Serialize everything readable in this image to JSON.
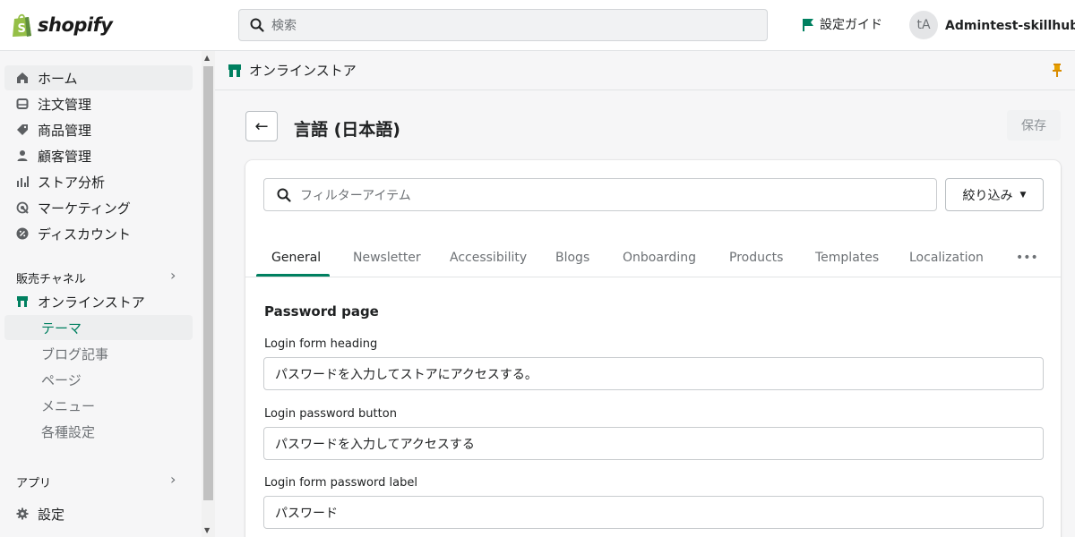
{
  "topbar": {
    "logo_text": "shopify",
    "search_placeholder": "検索",
    "setup_guide": "設定ガイド",
    "avatar_initials": "tA",
    "user_name": "Admintest-skillhubスト",
    "brand_color": "#008060"
  },
  "sidebar": {
    "items": [
      {
        "label": "ホーム",
        "icon": "home-icon"
      },
      {
        "label": "注文管理",
        "icon": "inbox-icon"
      },
      {
        "label": "商品管理",
        "icon": "tag-icon"
      },
      {
        "label": "顧客管理",
        "icon": "person-icon"
      },
      {
        "label": "ストア分析",
        "icon": "bar-chart-icon"
      },
      {
        "label": "マーケティング",
        "icon": "target-icon"
      },
      {
        "label": "ディスカウント",
        "icon": "discount-icon"
      }
    ],
    "sales_channels_title": "販売チャネル",
    "online_store": "オンラインストア",
    "sub_items": [
      "テーマ",
      "ブログ記事",
      "ページ",
      "メニュー",
      "各種設定"
    ],
    "apps_title": "アプリ",
    "settings": "設定"
  },
  "main": {
    "breadcrumb": "オンラインストア",
    "page_title": "言語 (日本語)",
    "save_label": "保存",
    "filter_placeholder": "フィルターアイテム",
    "filter_button": "絞り込み",
    "tabs": [
      "General",
      "Newsletter",
      "Accessibility",
      "Blogs",
      "Onboarding",
      "Products",
      "Templates",
      "Localization"
    ],
    "more_tabs": "•••",
    "section_title": "Password page",
    "fields": [
      {
        "label": "Login form heading",
        "value": "パスワードを入力してストアにアクセスする。"
      },
      {
        "label": "Login password button",
        "value": "パスワードを入力してアクセスする"
      },
      {
        "label": "Login form password label",
        "value": "パスワード"
      }
    ]
  }
}
